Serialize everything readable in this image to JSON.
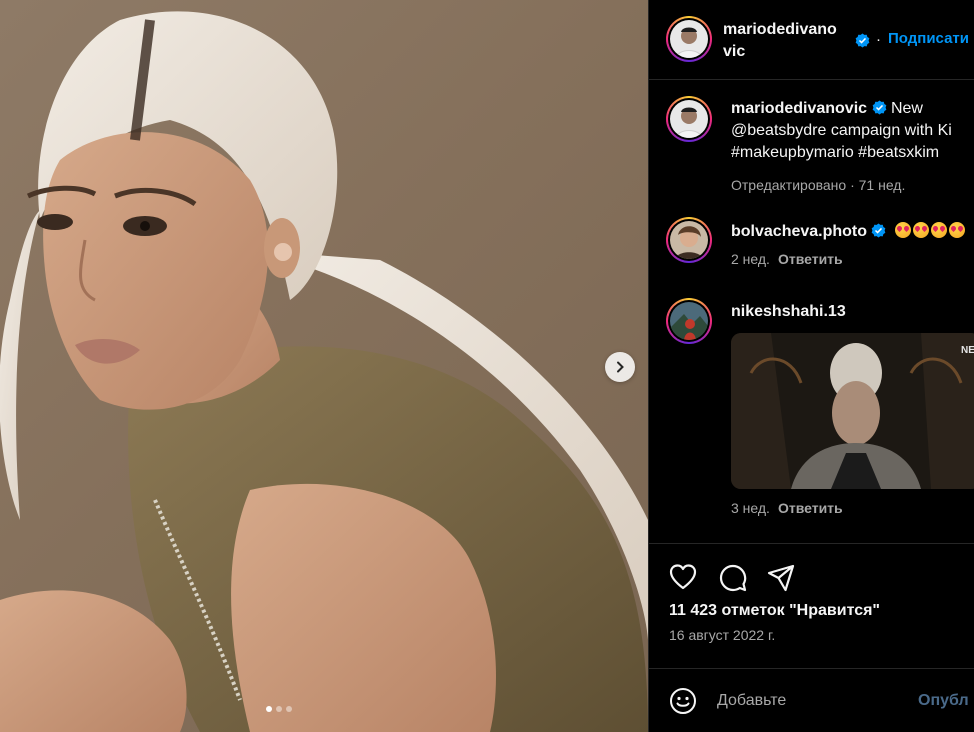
{
  "post": {
    "media": {
      "dots": [
        true,
        false,
        false
      ]
    }
  },
  "header": {
    "username_line1": "mariodedivano",
    "username_line2": "vic",
    "separator": "·",
    "follow_label": "Подписати"
  },
  "caption": {
    "username": "mariodedivanovic",
    "line1": "New",
    "line2": "@beatsbydre campaign with Ki",
    "line3": "#makeupbymario #beatsxkim",
    "meta": "Отредактировано · 71 нед."
  },
  "comments": [
    {
      "username": "bolvacheva.photo",
      "time": "2 нед.",
      "reply_label": "Ответить"
    },
    {
      "username": "nikeshshahi.13",
      "gif_watermark": "NET",
      "time": "3 нед.",
      "reply_label": "Ответить"
    }
  ],
  "footer": {
    "likes": "11 423 отметок \"Нравится\"",
    "date": "16 август 2022 г.",
    "comment_placeholder": "Добавьте",
    "post_label": "Опубл"
  },
  "icons": {
    "like": "heart-icon",
    "comment": "comment-icon",
    "share": "send-icon",
    "emoji": "smiley-icon",
    "next": "chevron-right-icon",
    "verified": "verified-badge-icon"
  },
  "colors": {
    "follow": "#0095f6",
    "verified": "#0095f6",
    "muted": "#a8a8a8",
    "background": "#000000"
  }
}
